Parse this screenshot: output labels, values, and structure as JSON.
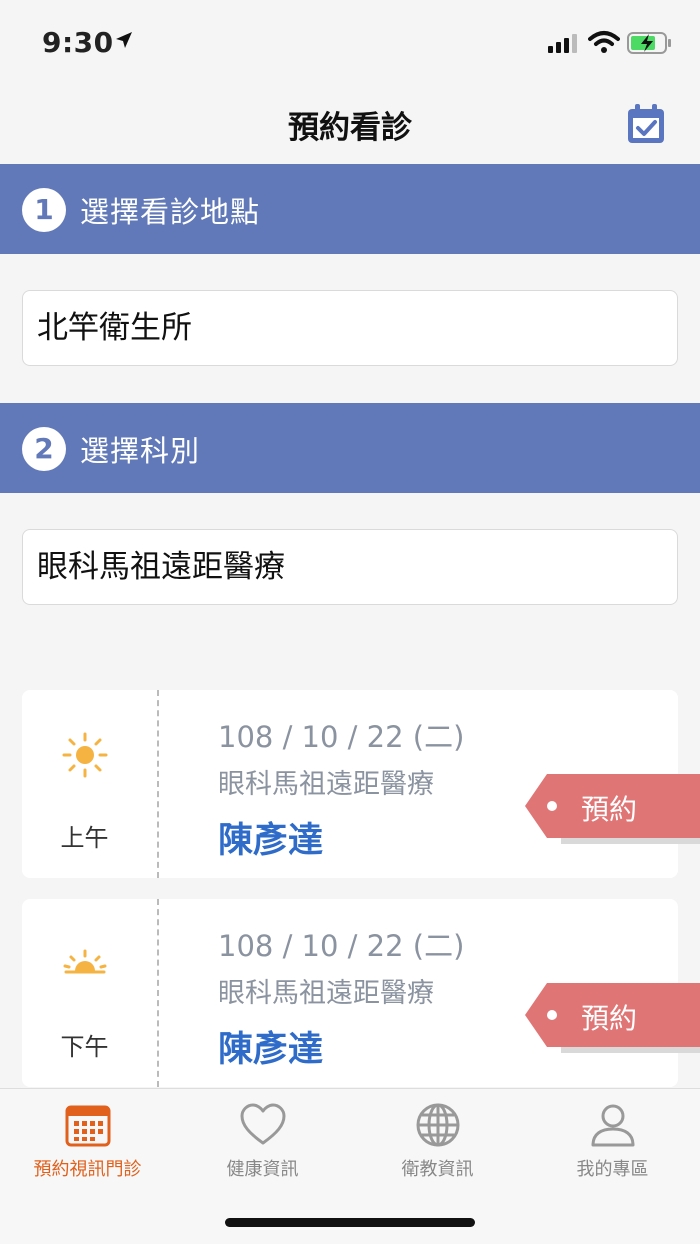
{
  "status_bar": {
    "time": "9:30"
  },
  "nav": {
    "title": "預約看診"
  },
  "steps": [
    {
      "number": "1",
      "title": "選擇看診地點",
      "value": "北竿衛生所"
    },
    {
      "number": "2",
      "title": "選擇科別",
      "value": "眼科馬祖遠距醫療"
    }
  ],
  "slots": [
    {
      "period": "上午",
      "icon": "sun-icon",
      "date": "108 / 10 / 22 (二)",
      "department": "眼科馬祖遠距醫療",
      "doctor": "陳彥達",
      "action": "預約"
    },
    {
      "period": "下午",
      "icon": "sunset-icon",
      "date": "108 / 10 / 22 (二)",
      "department": "眼科馬祖遠距醫療",
      "doctor": "陳彥達",
      "action": "預約"
    }
  ],
  "tabs": [
    {
      "label": "預約視訊門診",
      "icon": "calendar-grid-icon",
      "active": true
    },
    {
      "label": "健康資訊",
      "icon": "heart-icon",
      "active": false
    },
    {
      "label": "衛教資訊",
      "icon": "globe-icon",
      "active": false
    },
    {
      "label": "我的專區",
      "icon": "user-icon",
      "active": false
    }
  ],
  "colors": {
    "section_header": "#6179b8",
    "doctor_text": "#2f6cc9",
    "book_tag": "#e07575",
    "active_tab": "#e0601c",
    "sun": "#f5b342"
  }
}
